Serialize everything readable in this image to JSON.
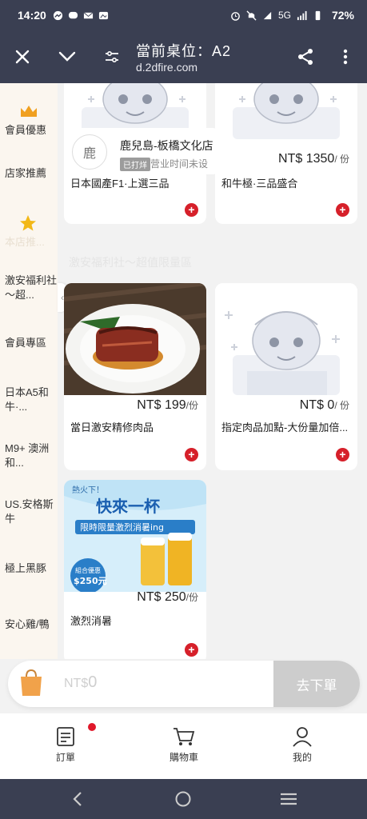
{
  "status_bar": {
    "time": "14:20",
    "network": "5G",
    "battery": "72%"
  },
  "header": {
    "title": "當前桌位：A2",
    "url": "d.2dfire.com"
  },
  "sidebar": {
    "items": [
      {
        "label": "會員優惠"
      },
      {
        "label": "店家推薦"
      },
      {
        "label": "本店推..."
      },
      {
        "label": "激安福利社～超..."
      },
      {
        "label": "會員專區"
      },
      {
        "label": "日本A5和牛·..."
      },
      {
        "label": "M9+ 澳洲和..."
      },
      {
        "label": "US.安格斯牛"
      },
      {
        "label": "極上黑豚"
      },
      {
        "label": "安心雞/鴨"
      }
    ]
  },
  "store": {
    "avatar_text": "鹿",
    "name": "鹿兒島-板橋文化店",
    "badge": "已打烊",
    "hours": "营业时间未设"
  },
  "section_title": "激安福利社～超值限量區",
  "products": [
    {
      "name": "日本國產F1·上選三品",
      "currency": "",
      "price": "",
      "unit": ""
    },
    {
      "name": "和牛極·三品盛合",
      "currency": "NT$",
      "price": "1350",
      "unit": "/ 份"
    },
    {
      "name": "當日激安精修肉品",
      "currency": "NT$",
      "price": "199",
      "unit": "/份"
    },
    {
      "name": "指定肉品加點-大份量加倍...",
      "currency": "NT$",
      "price": "0",
      "unit": "/ 份"
    },
    {
      "name": "激烈消暑",
      "currency": "NT$",
      "price": "250",
      "unit": "/份"
    }
  ],
  "promo_poster": {
    "line1": "熱火下！",
    "line2": "快來一杯",
    "line3": "限時限量激烈消暑ing",
    "combo": "組合優惠",
    "combo_price": "$250元"
  },
  "cart": {
    "currency": "NT$",
    "total": "0",
    "checkout_label": "去下單"
  },
  "bottom_nav": {
    "orders": "訂單",
    "cart": "購物車",
    "mine": "我的"
  },
  "colors": {
    "header_bg": "#3a3f52",
    "add_button": "#d6202a",
    "sidebar_bg": "#fbf6ef"
  }
}
